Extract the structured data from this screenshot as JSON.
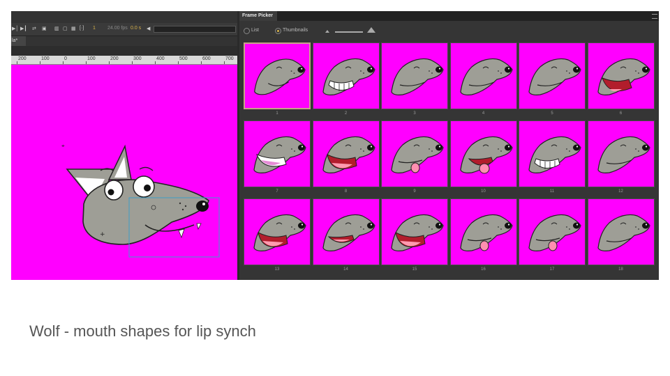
{
  "timeline": {
    "frame": "1",
    "fps": "24.00 fps",
    "time": "0.0 s"
  },
  "document": {
    "tab_label": "la*"
  },
  "ruler_labels": [
    "200",
    "100",
    "0",
    "100",
    "200",
    "300",
    "400",
    "500",
    "600",
    "700"
  ],
  "frame_picker": {
    "title": "Frame Picker",
    "view_list_label": "List",
    "view_thumbnails_label": "Thumbnails",
    "selected_view": "Thumbnails",
    "selected_frame": "1",
    "frames": [
      {
        "number": "1",
        "mouth": "smile"
      },
      {
        "number": "2",
        "mouth": "teeth"
      },
      {
        "number": "3",
        "mouth": "closed"
      },
      {
        "number": "4",
        "mouth": "closed"
      },
      {
        "number": "5",
        "mouth": "closed"
      },
      {
        "number": "6",
        "mouth": "wide"
      },
      {
        "number": "7",
        "mouth": "teeth-pink"
      },
      {
        "number": "8",
        "mouth": "open"
      },
      {
        "number": "9",
        "mouth": "tongue"
      },
      {
        "number": "10",
        "mouth": "tongue-open"
      },
      {
        "number": "11",
        "mouth": "teeth"
      },
      {
        "number": "12",
        "mouth": "closed"
      },
      {
        "number": "13",
        "mouth": "open"
      },
      {
        "number": "14",
        "mouth": "small-open"
      },
      {
        "number": "15",
        "mouth": "open"
      },
      {
        "number": "16",
        "mouth": "tongue"
      },
      {
        "number": "17",
        "mouth": "tongue"
      },
      {
        "number": "18",
        "mouth": "closed"
      }
    ]
  },
  "colors": {
    "stage_background": "#ff00ff",
    "wolf_fur": "#9e9e96",
    "accent": "#d8b24a"
  },
  "caption": "Wolf - mouth shapes for lip synch"
}
